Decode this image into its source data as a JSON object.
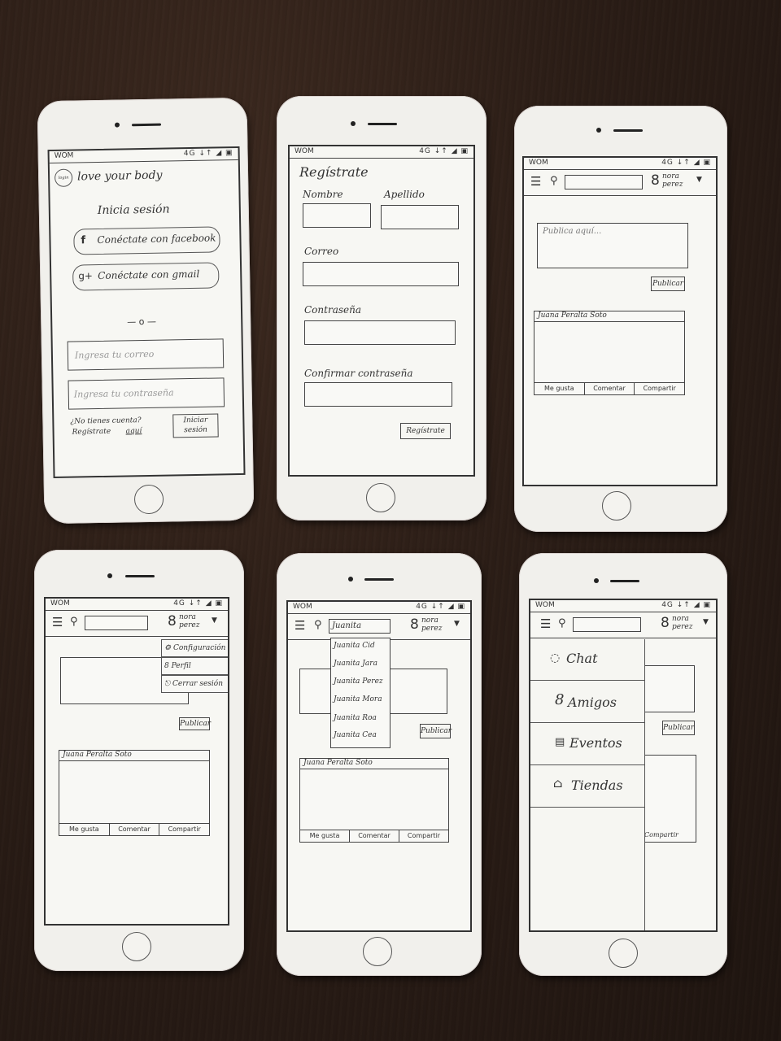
{
  "status": {
    "carrier": "WOM",
    "icons": "4G ↓↑ ◢ ▣"
  },
  "login": {
    "brand": "love your body",
    "logo_text": "login",
    "title": "Inicia sesión",
    "facebook_label": "Conéctate con facebook",
    "gmail_label": "Conéctate con gmail",
    "divider": "— o —",
    "email_placeholder": "Ingresa tu correo",
    "password_placeholder": "Ingresa tu contraseña",
    "no_account": "¿No tienes cuenta?",
    "register_prefix": "Regístrate",
    "register_link": "aquí",
    "login_button": "Iniciar sesión"
  },
  "register": {
    "title": "Regístrate",
    "first_name_label": "Nombre",
    "last_name_label": "Apellido",
    "email_label": "Correo",
    "password_label": "Contraseña",
    "confirm_label": "Confirmar contraseña",
    "submit": "Regístrate"
  },
  "feed": {
    "user_name": "nora perez",
    "post_placeholder": "Publica aquí...",
    "publish_button": "Publicar",
    "publish_button_short": "Publicar",
    "post_author": "Juana Peralta Soto",
    "like": "Me gusta",
    "comment": "Comentar",
    "share": "Compartir"
  },
  "profile_menu": {
    "items": [
      "Configuración",
      "Perfil",
      "Cerrar sesión"
    ]
  },
  "feed4": {
    "publish_button": "Publicar",
    "post_author": "Juana Peralta Soto",
    "like": "Me gusta",
    "comment": "Comentar",
    "share": "Compartir"
  },
  "search": {
    "query": "Juanita",
    "results": [
      "Juanita Cid",
      "Juanita Jara",
      "Juanita Perez",
      "Juanita Mora",
      "Juanita Roa",
      "Juanita Cea"
    ]
  },
  "sidebar": {
    "items": [
      {
        "label": "Chat",
        "icon": "chat-icon"
      },
      {
        "label": "Amigos",
        "icon": "friends-icon"
      },
      {
        "label": "Eventos",
        "icon": "calendar-icon"
      },
      {
        "label": "Tiendas",
        "icon": "store-icon"
      }
    ],
    "share": "Compartir",
    "publish": "Publicar"
  }
}
